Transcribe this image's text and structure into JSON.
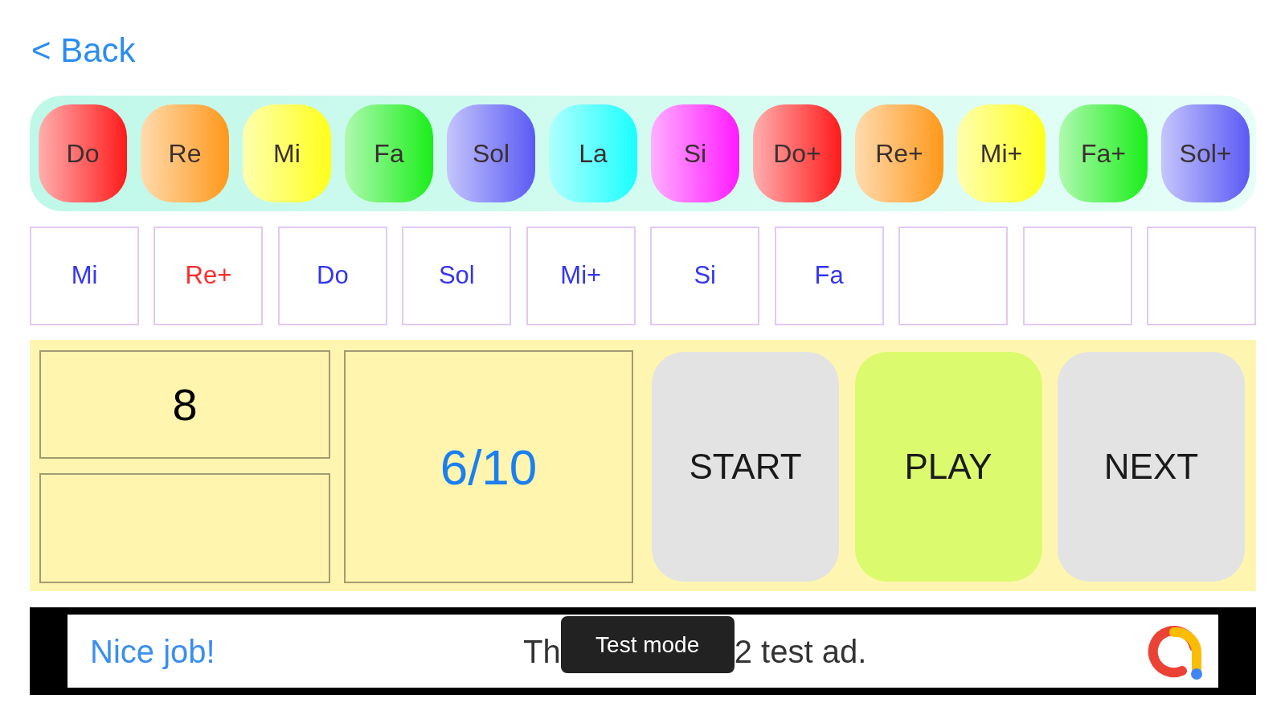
{
  "back_link": {
    "label": "< Back"
  },
  "keys": [
    {
      "label": "Do",
      "color": "#ff1a1a"
    },
    {
      "label": "Re",
      "color": "#ff981a"
    },
    {
      "label": "Mi",
      "color": "#ffff1a"
    },
    {
      "label": "Fa",
      "color": "#1aee1a"
    },
    {
      "label": "Sol",
      "color": "#5a5af5"
    },
    {
      "label": "La",
      "color": "#1affff"
    },
    {
      "label": "Si",
      "color": "#ff1aff"
    },
    {
      "label": "Do+",
      "color": "#ff1a1a"
    },
    {
      "label": "Re+",
      "color": "#ff981a"
    },
    {
      "label": "Mi+",
      "color": "#ffff1a"
    },
    {
      "label": "Fa+",
      "color": "#1aee1a"
    },
    {
      "label": "Sol+",
      "color": "#5a5af5"
    }
  ],
  "answers": [
    {
      "filled": true,
      "note": "Mi",
      "correct": true
    },
    {
      "filled": true,
      "note": "Re+",
      "correct": false
    },
    {
      "filled": true,
      "note": "Do",
      "correct": true
    },
    {
      "filled": true,
      "note": "Sol",
      "correct": true
    },
    {
      "filled": true,
      "note": "Mi+",
      "correct": true
    },
    {
      "filled": true,
      "note": "Si",
      "correct": true
    },
    {
      "filled": true,
      "note": "Fa",
      "correct": true
    },
    {
      "filled": false
    },
    {
      "filled": false
    },
    {
      "filled": false
    }
  ],
  "score_panel": {
    "counter": "8",
    "progress": "6/10"
  },
  "buttons": [
    {
      "label": "START",
      "active": false
    },
    {
      "label": "PLAY",
      "active": true
    },
    {
      "label": "NEXT",
      "active": false
    }
  ],
  "ad_banner": {
    "headline": "Nice job!",
    "text_before": "Th",
    "tooltip": "Test mode",
    "text_after": "2 test ad."
  }
}
